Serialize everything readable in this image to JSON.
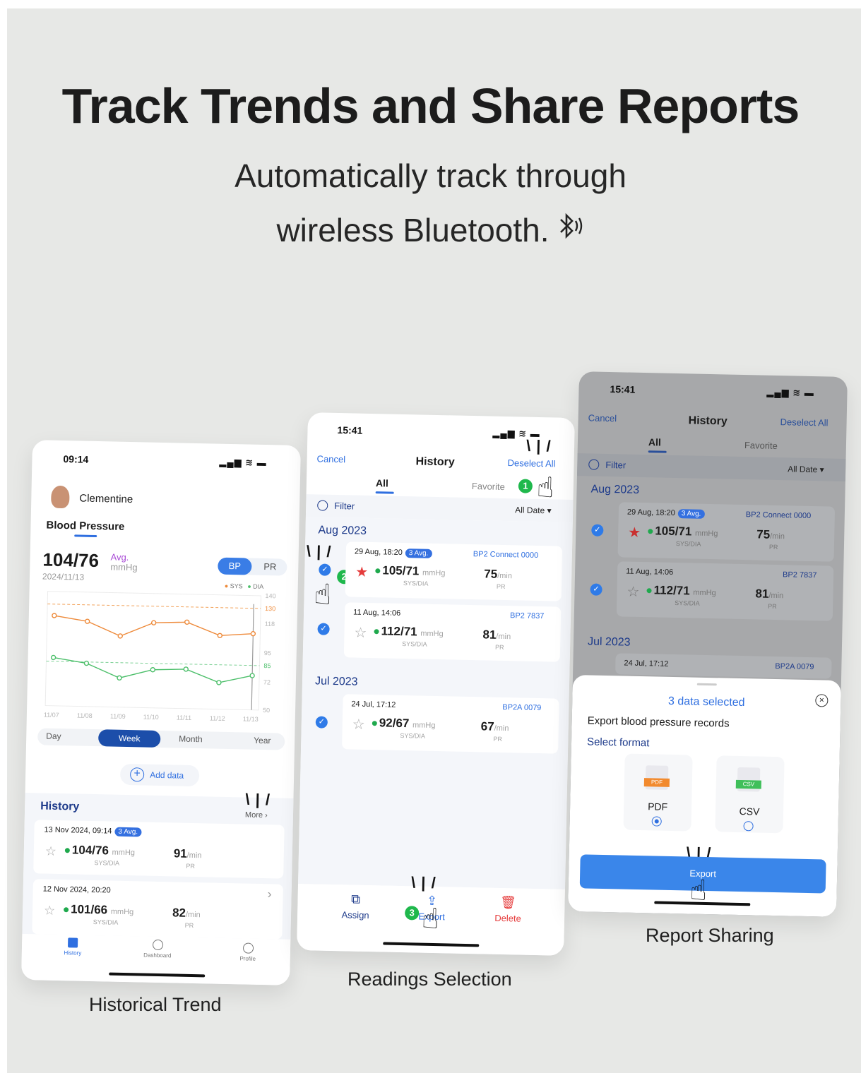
{
  "headline": "Track Trends and Share Reports",
  "subtitle": {
    "line1": "Automatically track through",
    "line2": "wireless Bluetooth.",
    "bluetooth_icon": "bluetooth-icon"
  },
  "captions": {
    "left": "Historical Trend",
    "middle": "Readings Selection",
    "right": "Report Sharing"
  },
  "phone1": {
    "time": "09:14",
    "user": "Clementine",
    "section": "Blood Pressure",
    "reading": "104/76",
    "avg": "Avg.",
    "unit": "mmHg",
    "date": "2024/11/13",
    "toggle": [
      "BP",
      "PR"
    ],
    "legend": [
      "SYS",
      "DIA"
    ],
    "ranges": [
      "Day",
      "Week",
      "Month",
      "Year"
    ],
    "active_range": "Week",
    "add_data": "Add data",
    "history_title": "History",
    "more": "More",
    "records": [
      {
        "time": "13 Nov 2024, 09:14",
        "avg": "3 Avg.",
        "bp": "104/76",
        "unit": "mmHg",
        "pr": "91",
        "pr_unit": "/min",
        "sub_bp": "SYS/DIA",
        "sub_pr": "PR"
      },
      {
        "time": "12 Nov 2024, 20:20",
        "avg": "",
        "bp": "101/66",
        "unit": "mmHg",
        "pr": "82",
        "pr_unit": "/min",
        "sub_bp": "SYS/DIA",
        "sub_pr": "PR"
      }
    ],
    "tabs": [
      "History",
      "Dashboard",
      "Profile"
    ]
  },
  "chart_data": {
    "type": "line",
    "x": [
      "11/07",
      "11/08",
      "11/09",
      "11/10",
      "11/11",
      "11/12",
      "11/13"
    ],
    "series": [
      {
        "name": "SYS",
        "values": [
          121,
          117,
          106,
          117,
          118,
          108,
          110
        ],
        "color": "#ee8a3a"
      },
      {
        "name": "DIA",
        "values": [
          88,
          84,
          73,
          80,
          81,
          71,
          77
        ],
        "color": "#4cbf6a"
      }
    ],
    "y_ticks": [
      "140",
      "130",
      "118",
      "95",
      "85",
      "72",
      "50"
    ],
    "ylim": [
      50,
      140
    ],
    "reference_lines": [
      130,
      85
    ]
  },
  "phone2": {
    "time": "15:41",
    "cancel": "Cancel",
    "title": "History",
    "deselect": "Deselect All",
    "tab_all": "All",
    "tab_fav": "Favorite",
    "filter": "Filter",
    "all_date": "All Date",
    "month1": "Aug 2023",
    "month2": "Jul 2023",
    "records": [
      {
        "time": "29 Aug, 18:20",
        "avg": "3 Avg.",
        "device": "BP2 Connect  0000",
        "bp": "105/71",
        "unit": "mmHg",
        "pr": "75",
        "pr_unit": "/min",
        "sub_bp": "SYS/DIA",
        "sub_pr": "PR"
      },
      {
        "time": "11 Aug, 14:06",
        "avg": "",
        "device": "BP2  7837",
        "bp": "112/71",
        "unit": "mmHg",
        "pr": "81",
        "pr_unit": "/min",
        "sub_bp": "SYS/DIA",
        "sub_pr": "PR"
      },
      {
        "time": "24 Jul, 17:12",
        "avg": "",
        "device": "BP2A  0079",
        "bp": "92/67",
        "unit": "mmHg",
        "pr": "67",
        "pr_unit": "/min",
        "sub_bp": "SYS/DIA",
        "sub_pr": "PR"
      }
    ],
    "actions": [
      "Assign",
      "Export",
      "Delete"
    ],
    "steps": [
      "1",
      "2",
      "3"
    ]
  },
  "phone3": {
    "time": "15:41",
    "cancel": "Cancel",
    "title": "History",
    "deselect": "Deselect All",
    "tab_all": "All",
    "tab_fav": "Favorite",
    "filter": "Filter",
    "all_date": "All Date",
    "month1": "Aug 2023",
    "month2": "Jul 2023",
    "records": [
      {
        "time": "29 Aug, 18:20",
        "avg": "3 Avg.",
        "device": "BP2 Connect  0000",
        "bp": "105/71",
        "unit": "mmHg",
        "pr": "75",
        "pr_unit": "/min",
        "sub_bp": "SYS/DIA",
        "sub_pr": "PR"
      },
      {
        "time": "11 Aug, 14:06",
        "avg": "",
        "device": "BP2  7837",
        "bp": "112/71",
        "unit": "mmHg",
        "pr": "81",
        "pr_unit": "/min",
        "sub_bp": "SYS/DIA",
        "sub_pr": "PR"
      },
      {
        "time": "24 Jul, 17:12",
        "device": "BP2A  0079"
      }
    ],
    "sheet": {
      "selected": "3 data selected",
      "heading": "Export blood pressure records",
      "select_format": "Select format",
      "formats": [
        {
          "label": "PDF",
          "badge": "PDF",
          "selected": true
        },
        {
          "label": "CSV",
          "badge": "CSV",
          "selected": false
        }
      ],
      "export": "Export"
    }
  }
}
